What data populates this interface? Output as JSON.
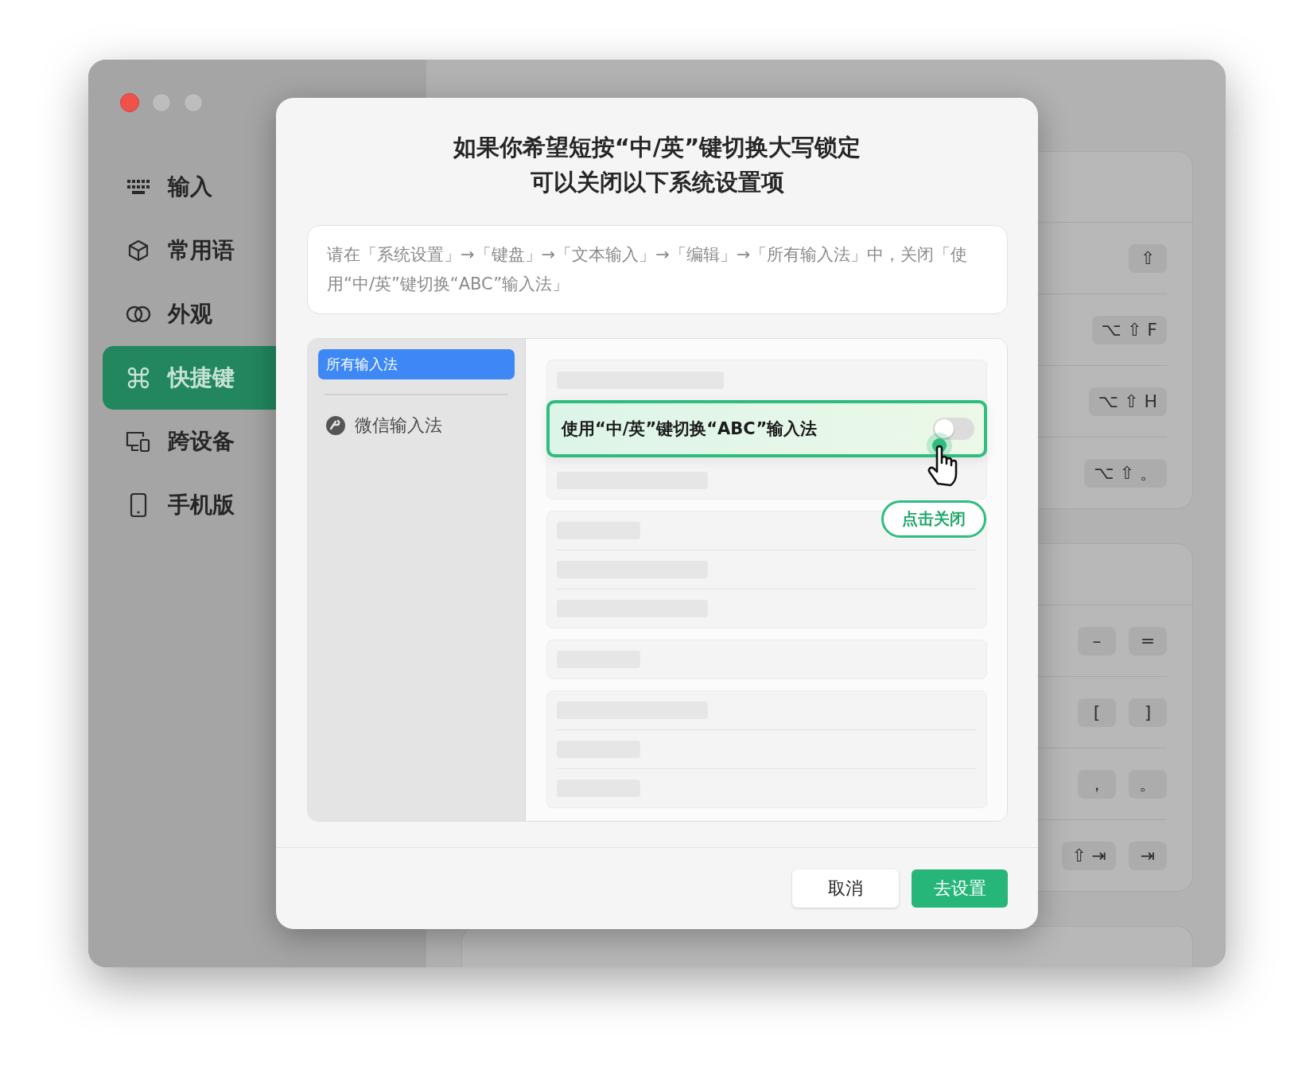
{
  "sidebar": {
    "items": [
      {
        "label": "输入",
        "selected": false
      },
      {
        "label": "常用语",
        "selected": false
      },
      {
        "label": "外观",
        "selected": false
      },
      {
        "label": "快捷键",
        "selected": true
      },
      {
        "label": "跨设备",
        "selected": false
      },
      {
        "label": "手机版",
        "selected": false
      }
    ]
  },
  "shortcut_cards": [
    {
      "rows": [
        {
          "keys": [
            "⇧"
          ]
        },
        {
          "keys": [
            "⌥ ⇧ F"
          ]
        },
        {
          "keys": [
            "⌥ ⇧ H"
          ]
        },
        {
          "keys": [
            "⌥ ⇧ 。"
          ]
        }
      ]
    },
    {
      "rows": [
        {
          "keys": [
            "–",
            "="
          ]
        },
        {
          "keys": [
            "[",
            "]"
          ]
        },
        {
          "keys": [
            "，",
            "。"
          ]
        },
        {
          "keys": [
            "⇧ ⇥",
            "⇥"
          ]
        }
      ]
    }
  ],
  "dialog": {
    "title_lines": [
      "如果你希望短按“中/英”键切换大写锁定",
      "可以关闭以下系统设置项"
    ],
    "instruction": "请在「系统设置」→「键盘」→「文本输入」→「编辑」→「所有输入法」中，关闭「使用“中/英”键切换“ABC”输入法」",
    "illustration": {
      "sources": [
        {
          "label": "所有输入法",
          "selected": true
        },
        {
          "label": "微信输入法",
          "selected": false
        }
      ],
      "highlighted_setting": {
        "label": "使用“中/英”键切换“ABC”输入法",
        "on": false
      },
      "callout": "点击关闭"
    },
    "buttons": [
      {
        "label": "取消",
        "kind": "secondary"
      },
      {
        "label": "去设置",
        "kind": "primary"
      }
    ]
  }
}
